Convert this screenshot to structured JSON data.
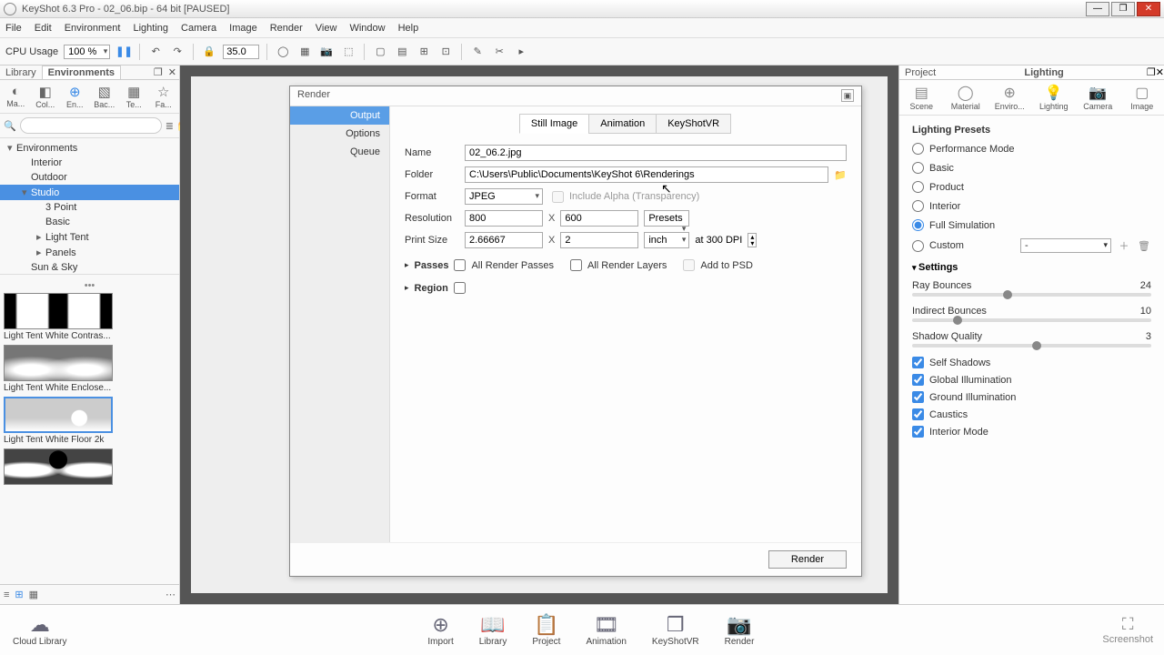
{
  "window": {
    "title": "KeyShot 6.3 Pro  - 02_06.bip  - 64 bit [PAUSED]",
    "min": "—",
    "max": "❐",
    "close": "✕"
  },
  "menu": [
    "File",
    "Edit",
    "Environment",
    "Lighting",
    "Camera",
    "Image",
    "Render",
    "View",
    "Window",
    "Help"
  ],
  "toolbar": {
    "cpu_label": "CPU Usage",
    "cpu_value": "100 %",
    "fov_value": "35.0"
  },
  "library": {
    "tab_library": "Library",
    "tab_env": "Environments",
    "icons": [
      {
        "label": "Ma..."
      },
      {
        "label": "Col..."
      },
      {
        "label": "En..."
      },
      {
        "label": "Bac..."
      },
      {
        "label": "Te..."
      },
      {
        "label": "Fa..."
      }
    ],
    "search_ph": "",
    "tree": [
      {
        "label": "Environments",
        "lvl": 0,
        "arrow": "▾"
      },
      {
        "label": "Interior",
        "lvl": 1,
        "arrow": ""
      },
      {
        "label": "Outdoor",
        "lvl": 1,
        "arrow": ""
      },
      {
        "label": "Studio",
        "lvl": 1,
        "arrow": "▾",
        "sel": true
      },
      {
        "label": "3 Point",
        "lvl": 2,
        "arrow": ""
      },
      {
        "label": "Basic",
        "lvl": 2,
        "arrow": ""
      },
      {
        "label": "Light Tent",
        "lvl": 2,
        "arrow": "▸"
      },
      {
        "label": "Panels",
        "lvl": 2,
        "arrow": "▸"
      },
      {
        "label": "Sun & Sky",
        "lvl": 1,
        "arrow": ""
      }
    ],
    "thumbs": [
      {
        "cap": "Light Tent White Contras...",
        "cls": "t1"
      },
      {
        "cap": "Light Tent White Enclose...",
        "cls": "t2"
      },
      {
        "cap": "Light Tent White Floor 2k",
        "cls": "t3",
        "sel": true
      },
      {
        "cap": "",
        "cls": "t4"
      }
    ]
  },
  "dialog": {
    "title": "Render",
    "side": [
      "Output",
      "Options",
      "Queue"
    ],
    "tabs": [
      "Still Image",
      "Animation",
      "KeyShotVR"
    ],
    "name_lbl": "Name",
    "name_val": "02_06.2.jpg",
    "folder_lbl": "Folder",
    "folder_val": "C:\\Users\\Public\\Documents\\KeyShot 6\\Renderings",
    "format_lbl": "Format",
    "format_val": "JPEG",
    "alpha_lbl": "Include Alpha (Transparency)",
    "res_lbl": "Resolution",
    "res_w": "800",
    "res_h": "600",
    "presets_lbl": "Presets",
    "print_lbl": "Print Size",
    "print_w": "2.66667",
    "print_h": "2",
    "unit": "inch",
    "dpi_lbl": "at   300 DPI",
    "passes_lbl": "Passes",
    "p1": "All Render Passes",
    "p2": "All Render Layers",
    "p3": "Add to PSD",
    "region_lbl": "Region",
    "render_btn": "Render"
  },
  "project": {
    "tab_project": "Project",
    "tab_title": "Lighting",
    "icons": [
      "Scene",
      "Material",
      "Enviro...",
      "Lighting",
      "Camera",
      "Image"
    ],
    "presets_lbl": "Lighting Presets",
    "presets": [
      "Performance Mode",
      "Basic",
      "Product",
      "Interior",
      "Full Simulation",
      "Custom"
    ],
    "custom_sel": "-",
    "settings_lbl": "Settings",
    "sliders": [
      {
        "label": "Ray Bounces",
        "val": "24",
        "pos": 38
      },
      {
        "label": "Indirect Bounces",
        "val": "10",
        "pos": 17
      },
      {
        "label": "Shadow Quality",
        "val": "3",
        "pos": 50
      }
    ],
    "checks": [
      "Self Shadows",
      "Global Illumination",
      "Ground Illumination",
      "Caustics",
      "Interior Mode"
    ]
  },
  "bottom": {
    "cloud": "Cloud Library",
    "items": [
      "Import",
      "Library",
      "Project",
      "Animation",
      "KeyShotVR",
      "Render"
    ],
    "shot": "Screenshot"
  }
}
